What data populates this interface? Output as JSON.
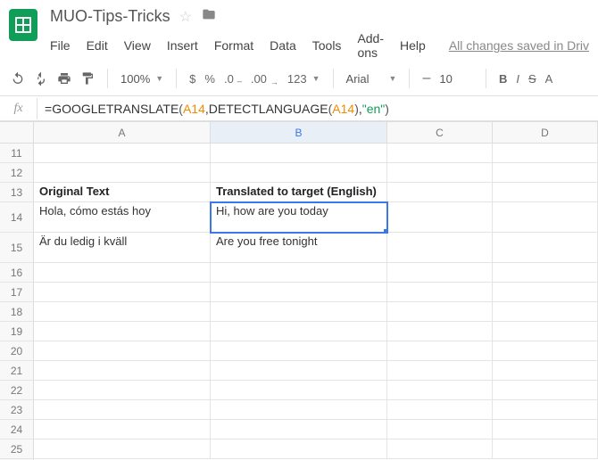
{
  "doc_title": "MUO-Tips-Tricks",
  "menu": {
    "file": "File",
    "edit": "Edit",
    "view": "View",
    "insert": "Insert",
    "format": "Format",
    "data": "Data",
    "tools": "Tools",
    "addons": "Add-ons",
    "help": "Help",
    "save_status": "All changes saved in Driv"
  },
  "toolbar": {
    "zoom": "100%",
    "currency": "$",
    "percent": "%",
    "dec_less": ".0",
    "dec_more": ".00",
    "num_format": "123",
    "font": "Arial",
    "font_size": "10",
    "bold": "B",
    "italic": "I",
    "strike": "S",
    "textcolor": "A"
  },
  "formula": {
    "fx": "fx",
    "eq": "=",
    "fn1": "GOOGLETRANSLATE",
    "ref1": "A14",
    "sep1": ",",
    "fn2": "DETECTLANGUAGE",
    "ref2": "A14",
    "sep2": ",",
    "str": "\"en\""
  },
  "columns": {
    "A": "A",
    "B": "B",
    "C": "C",
    "D": "D"
  },
  "rows": {
    "r11": "11",
    "r12": "12",
    "r13": "13",
    "r14": "14",
    "r15": "15",
    "r16": "16",
    "r17": "17",
    "r18": "18",
    "r19": "19",
    "r20": "20",
    "r21": "21",
    "r22": "22",
    "r23": "23",
    "r24": "24",
    "r25": "25"
  },
  "cells": {
    "A13": "Original Text",
    "B13": "Translated to target (English)",
    "A14": "Hola, cómo estás hoy",
    "B14": "Hi, how are you today",
    "A15": "Är du ledig i kväll",
    "B15": "Are you free tonight"
  }
}
